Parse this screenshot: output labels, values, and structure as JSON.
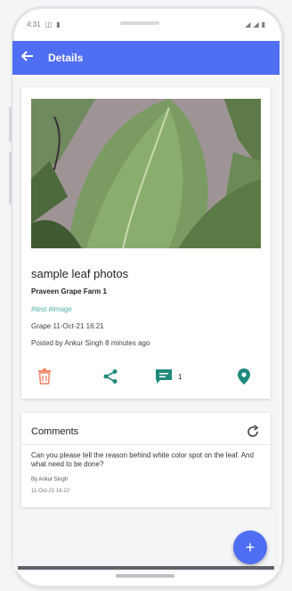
{
  "status_bar": {
    "time": "4:31"
  },
  "app_bar": {
    "back_icon": "arrow-left-icon",
    "title": "Details"
  },
  "post": {
    "title": "sample leaf photos",
    "farm": "Praveen Grape Farm 1",
    "tags": "#test #image",
    "crop_date": "Grape  11-Oct-21 16:21",
    "posted_by": "Posted by Ankur Singh 8 minutes ago",
    "actions": {
      "delete_icon": "trash-icon",
      "share_icon": "share-icon",
      "comment_icon": "comment-icon",
      "comment_count": "1",
      "location_icon": "location-pin-icon"
    }
  },
  "comments": {
    "header": "Comments",
    "refresh_icon": "refresh-icon",
    "items": [
      {
        "text": "Can you please tell the reason behind white color spot on the leaf. And what need to be done?",
        "author": "By Ankur Singh",
        "time": "11-Oct-21 16:22"
      }
    ]
  },
  "fab": {
    "label": "+"
  },
  "colors": {
    "primary": "#4f6ef3",
    "delete": "#f0876b",
    "teal": "#1f8a7c",
    "tag": "#4fb0a8"
  }
}
